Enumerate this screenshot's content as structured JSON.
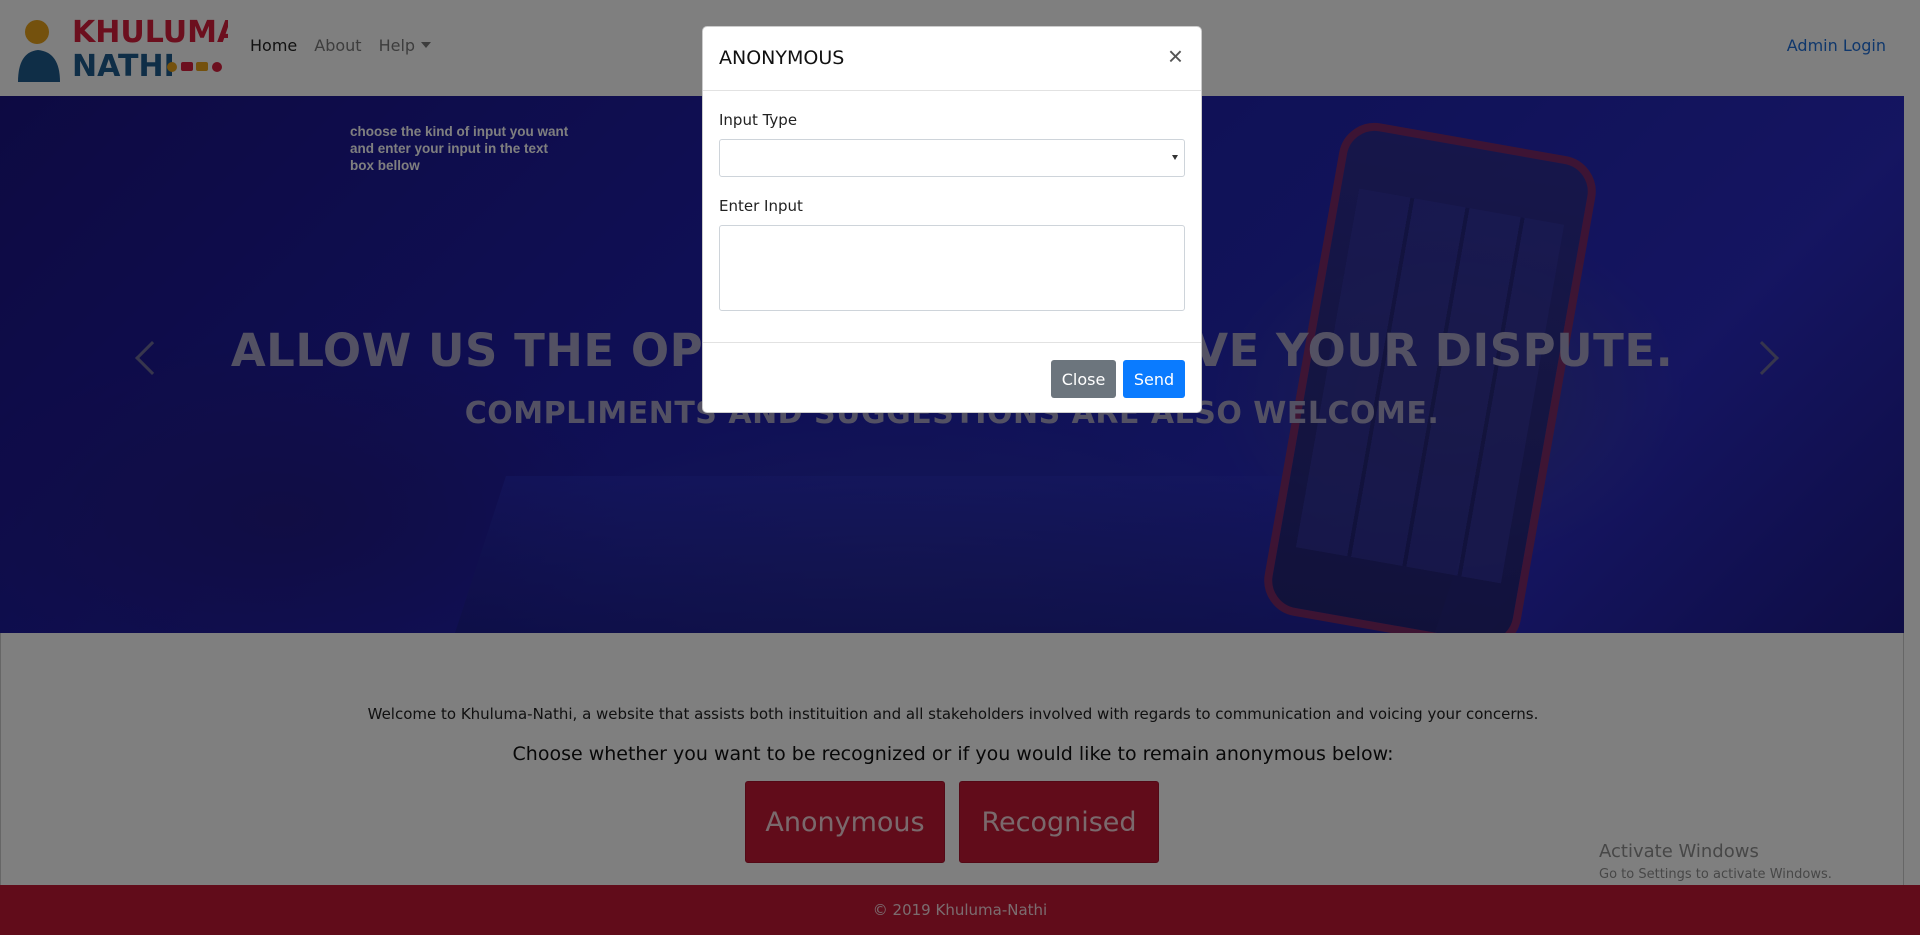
{
  "navbar": {
    "logo": {
      "line1": "KHULUMA",
      "line2": "NATHI"
    },
    "links": [
      {
        "label": "Home"
      },
      {
        "label": "About"
      },
      {
        "label": "Help"
      }
    ],
    "admin_login": "Admin Login"
  },
  "hero": {
    "note": "choose the kind of input you want and enter your input in the text box bellow",
    "title": "ALLOW US THE OPPORTUNITY TO SOLVE YOUR DISPUTE.",
    "subtitle": "COMPLIMENTS AND SUGGESTIONS ARE ALSO WELCOME.",
    "prev_icon": "chevron-left-icon",
    "next_icon": "chevron-right-icon"
  },
  "content": {
    "welcome": "Welcome to Khuluma-Nathi, a website that assists both instituition and all stakeholders involved with regards to communication and voicing your concerns.",
    "choose": "Choose whether you want to be recognized or if you would like to remain anonymous below:",
    "buttons": {
      "anonymous": "Anonymous",
      "recognised": "Recognised"
    }
  },
  "watermark": {
    "title": "Activate Windows",
    "subtitle": "Go to Settings to activate Windows."
  },
  "footer": {
    "text": "© 2019 Khuluma-Nathi"
  },
  "modal": {
    "title": "ANONYMOUS",
    "close_icon": "×",
    "input_type_label": "Input Type",
    "input_type_value": "",
    "enter_input_label": "Enter Input",
    "enter_input_value": "",
    "close_button": "Close",
    "send_button": "Send"
  },
  "colors": {
    "brand_red": "#c21835",
    "primary_blue": "#0a7bff",
    "secondary_gray": "#6c757d",
    "link_blue": "#1e6fd9"
  }
}
